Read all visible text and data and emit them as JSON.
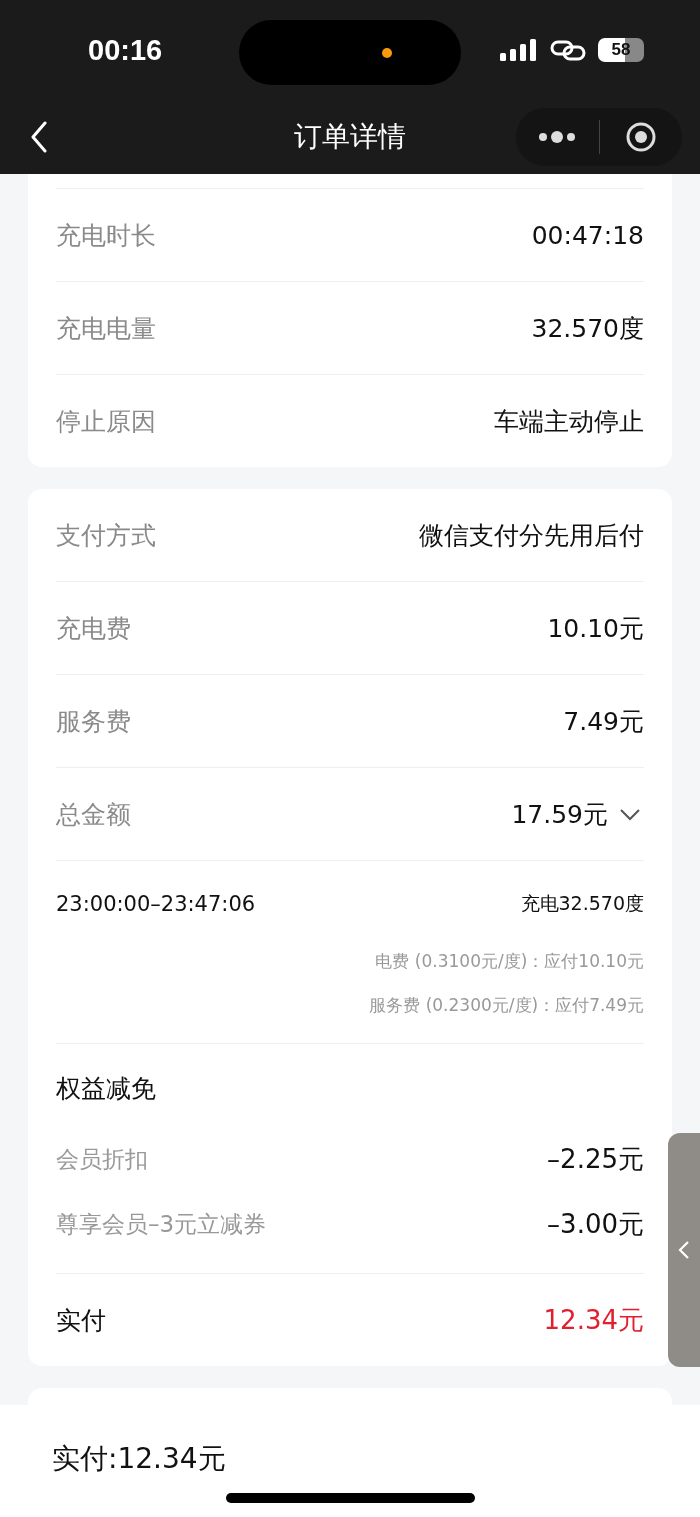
{
  "status_bar": {
    "time": "00:16",
    "battery": "58"
  },
  "nav": {
    "title": "订单详情"
  },
  "charging_info": [
    {
      "label": "充电时长",
      "value": "00:47:18"
    },
    {
      "label": "充电电量",
      "value": "32.570度"
    },
    {
      "label": "停止原因",
      "value": "车端主动停止"
    }
  ],
  "payment": {
    "rows": [
      {
        "label": "支付方式",
        "value": "微信支付分先用后付"
      },
      {
        "label": "充电费",
        "value": "10.10元"
      },
      {
        "label": "服务费",
        "value": "7.49元"
      }
    ],
    "total": {
      "label": "总金额",
      "value": "17.59元",
      "expanded": true
    },
    "breakdown": {
      "period": "23:00:00–23:47:06",
      "energy": "充电32.570度",
      "lines": [
        "电费 (0.3100元/度)：应付10.10元",
        "服务费 (0.2300元/度)：应付7.49元"
      ]
    },
    "discounts": {
      "title": "权益减免",
      "items": [
        {
          "label": "会员折扣",
          "value": "–2.25元"
        },
        {
          "label": "尊享会员–3元立减券",
          "value": "–3.00元"
        }
      ]
    },
    "paid": {
      "label": "实付",
      "value": "12.34元"
    }
  },
  "bottom_bar": {
    "text": "实付:12.34元"
  }
}
